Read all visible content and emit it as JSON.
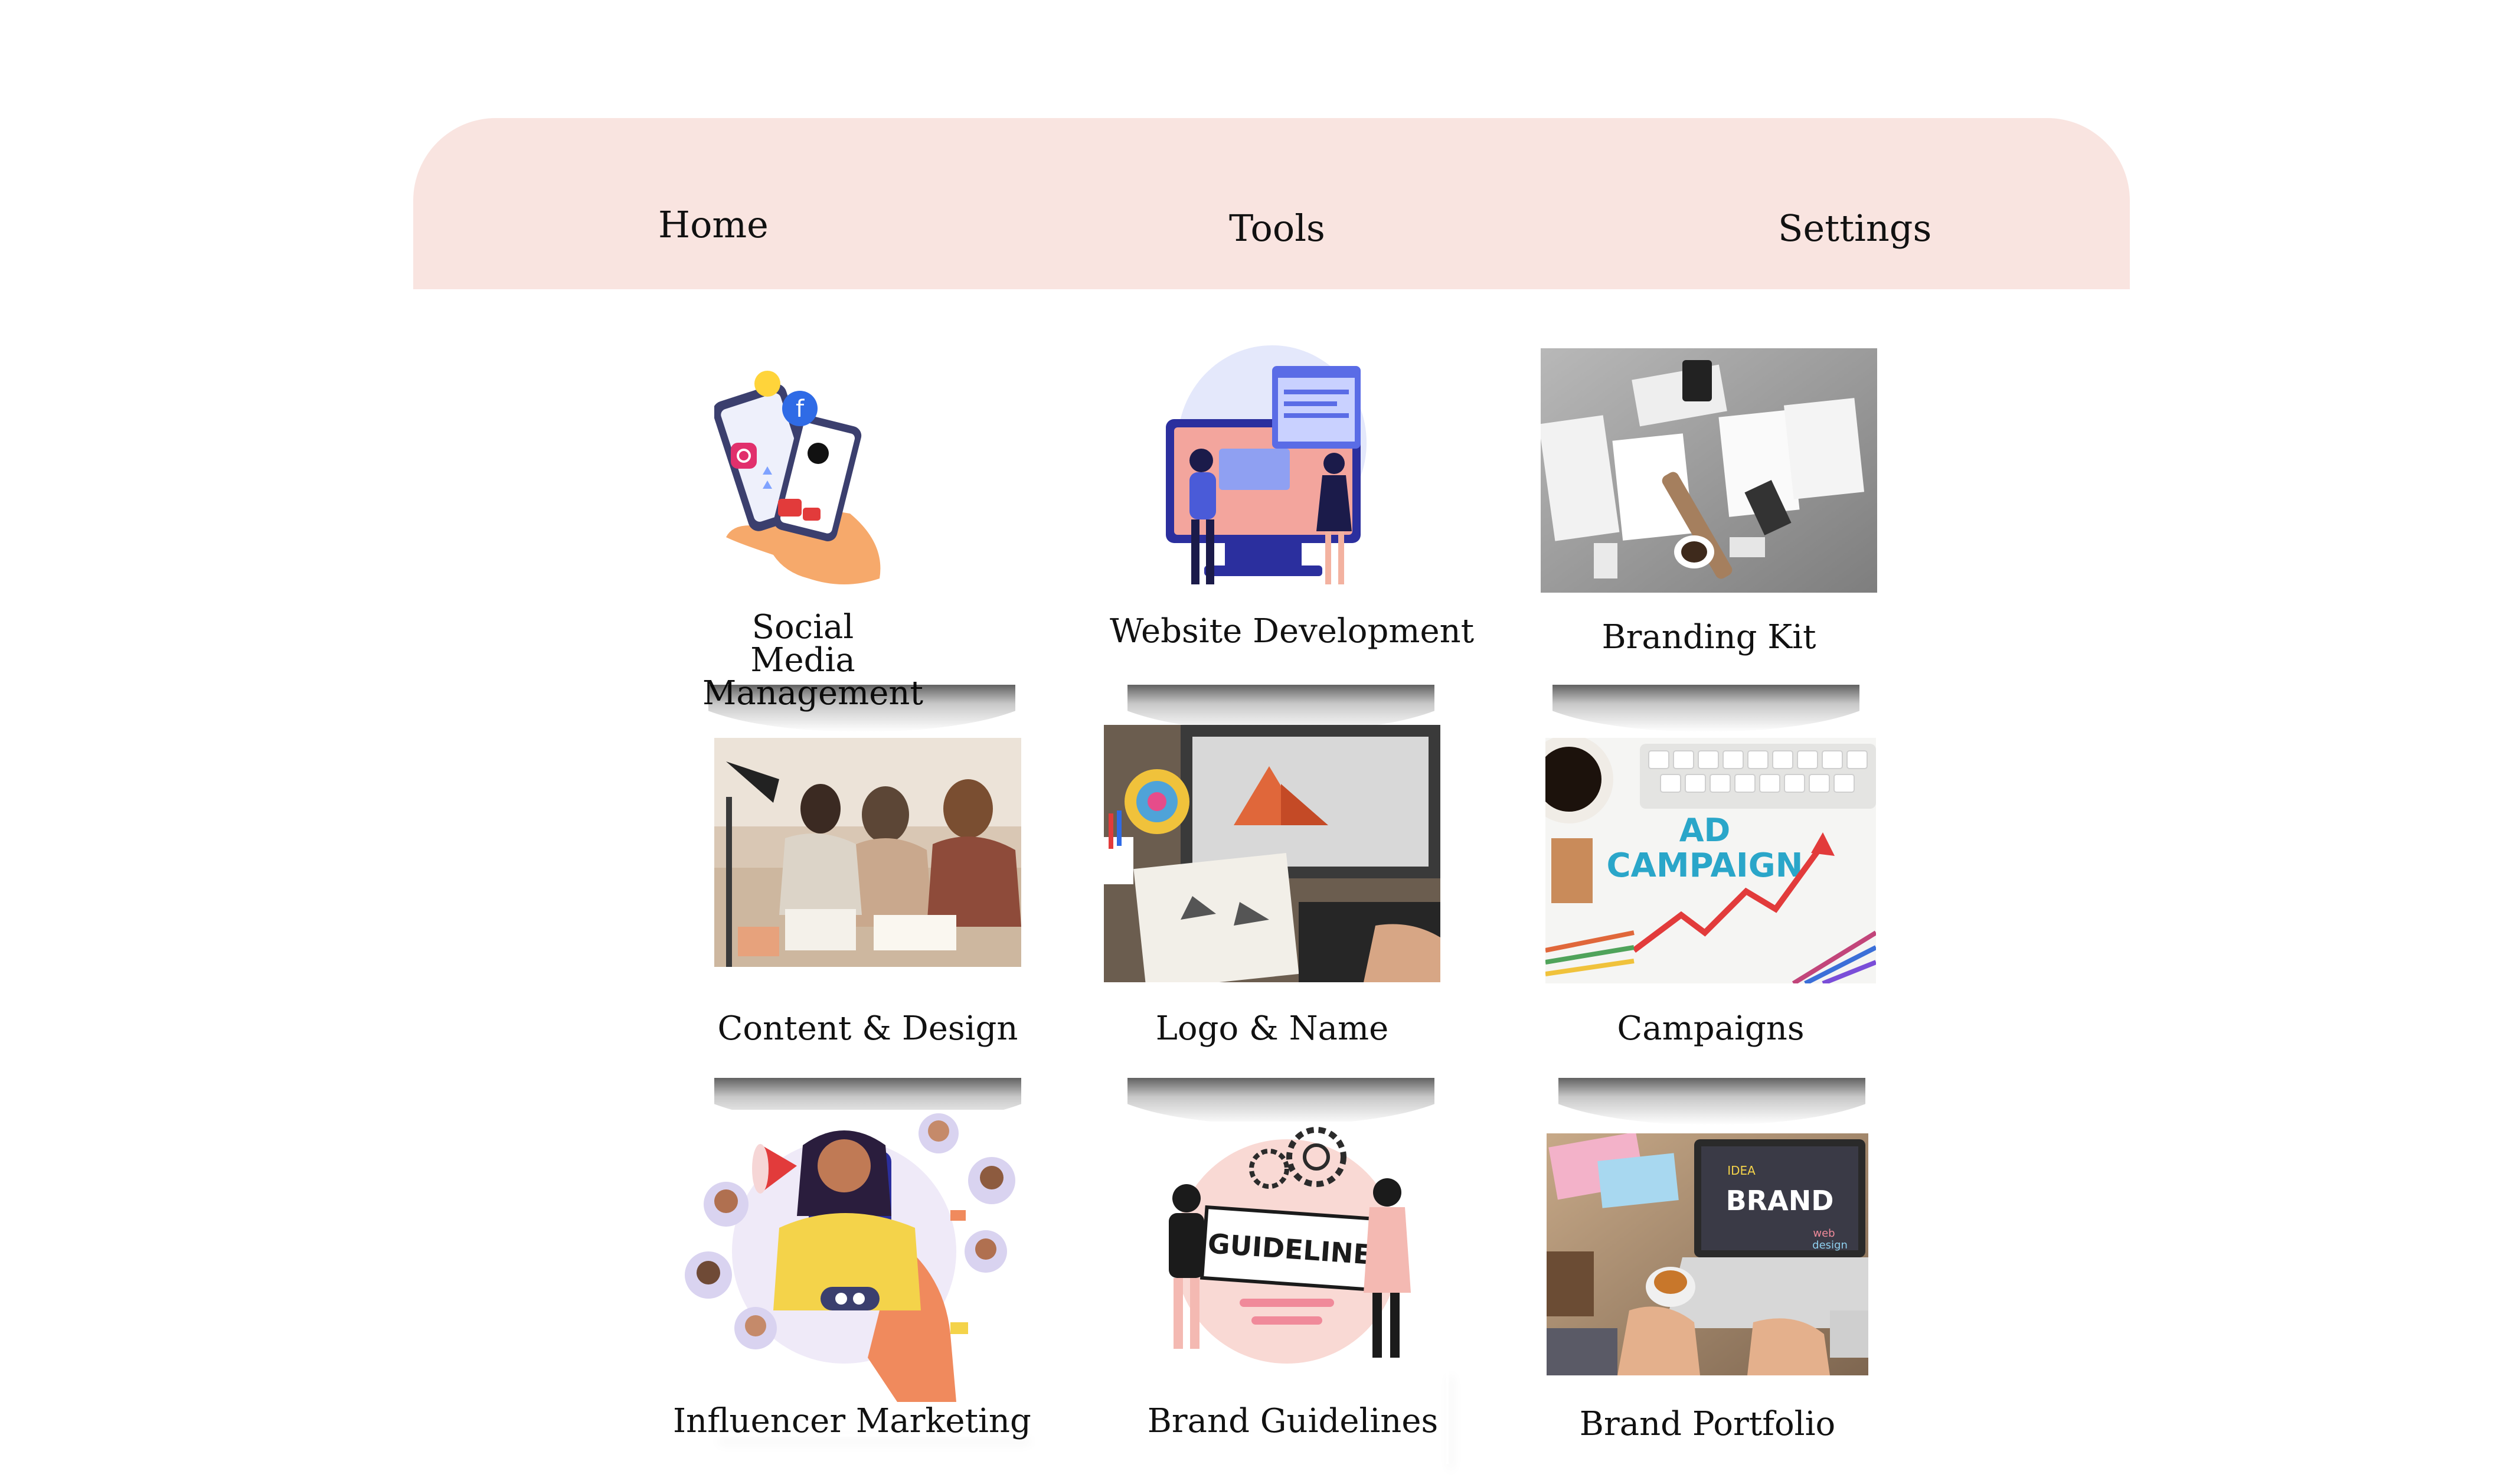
{
  "nav": {
    "home_label": "Home",
    "tools_label": "Tools",
    "settings_label": "Settings"
  },
  "tiles": [
    {
      "label": "Social Media Management",
      "image": "social-media-phone-illustration"
    },
    {
      "label": "Website Development",
      "image": "website-development-illustration"
    },
    {
      "label": "Branding Kit",
      "image": "branding-kit-photo"
    },
    {
      "label": "Content & Design",
      "image": "content-design-team-photo"
    },
    {
      "label": "Logo & Name",
      "image": "logo-sketching-photo"
    },
    {
      "label": "Campaigns",
      "image": "ad-campaign-photo"
    },
    {
      "label": "Influencer Marketing",
      "image": "influencer-marketing-illustration"
    },
    {
      "label": "Brand Guidelines",
      "image": "brand-guidelines-illustration"
    },
    {
      "label": "Brand Portfolio",
      "image": "brand-portfolio-photo"
    }
  ],
  "image_text": {
    "ad_campaign_line1": "AD",
    "ad_campaign_line2": "CAMPAIGN",
    "guideline_sign": "GUIDELINE",
    "brand_screen": "BRAND",
    "brand_idea": "IDEA",
    "brand_web": "web",
    "brand_design": "design"
  },
  "colors": {
    "nav_background": "#f9e4e0",
    "accent_orange": "#f08a5d",
    "accent_blue": "#4a5bd8",
    "accent_pink": "#f4b9b2"
  }
}
